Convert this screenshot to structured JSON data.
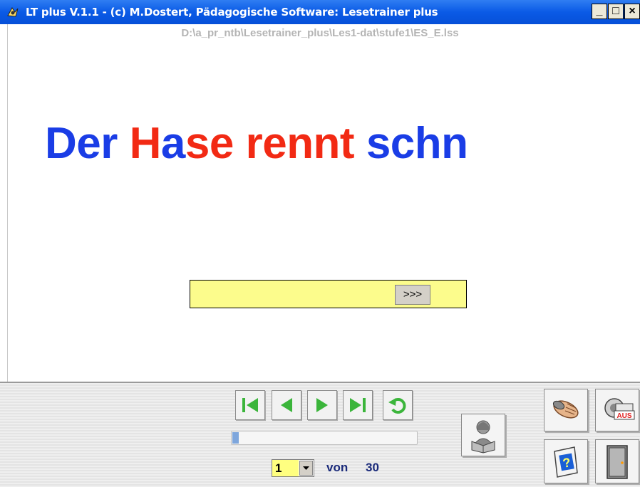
{
  "window": {
    "title": "LT plus   V.1.1 - (c) M.Dostert, Pädagogische Software: Lesetrainer plus",
    "minimize_label": "_",
    "maximize_label": "□",
    "close_label": "×"
  },
  "file_path": "D:\\a_pr_ntb\\Lesetrainer_plus\\Les1-dat\\stufe1\\ES_E.lss",
  "sentence": {
    "parts": [
      {
        "text": "Der ",
        "color": "#1a3de6"
      },
      {
        "text": "H",
        "color": "#f22a14"
      },
      {
        "text": "a",
        "color": "#1a3de6"
      },
      {
        "text": "se ",
        "color": "#f22a14"
      },
      {
        "text": "rennt ",
        "color": "#f22a14"
      },
      {
        "text": "schn",
        "color": "#1a3de6"
      }
    ]
  },
  "answer": {
    "value": "",
    "next_button_label": ">>>"
  },
  "navigation": {
    "buttons": [
      "first-icon",
      "previous-icon",
      "next-icon",
      "last-icon",
      "repeat-icon"
    ],
    "progress_fraction": 0.033
  },
  "pager": {
    "current_page": "1",
    "von_label": "von",
    "total_pages": "30"
  },
  "tools": {
    "read_icon": "reading-person-icon",
    "mouse_icon": "hand-mouse-icon",
    "sound_off_icon": "speaker-aus-icon",
    "sound_off_label": "AUS",
    "help_icon": "help-icon",
    "exit_icon": "exit-door-icon"
  },
  "colors": {
    "titlebar": "#0a5ae6",
    "input_bg": "#fcfc8c",
    "nav_green": "#3bb53b",
    "sentence_blue": "#1a3de6",
    "sentence_red": "#f22a14"
  }
}
